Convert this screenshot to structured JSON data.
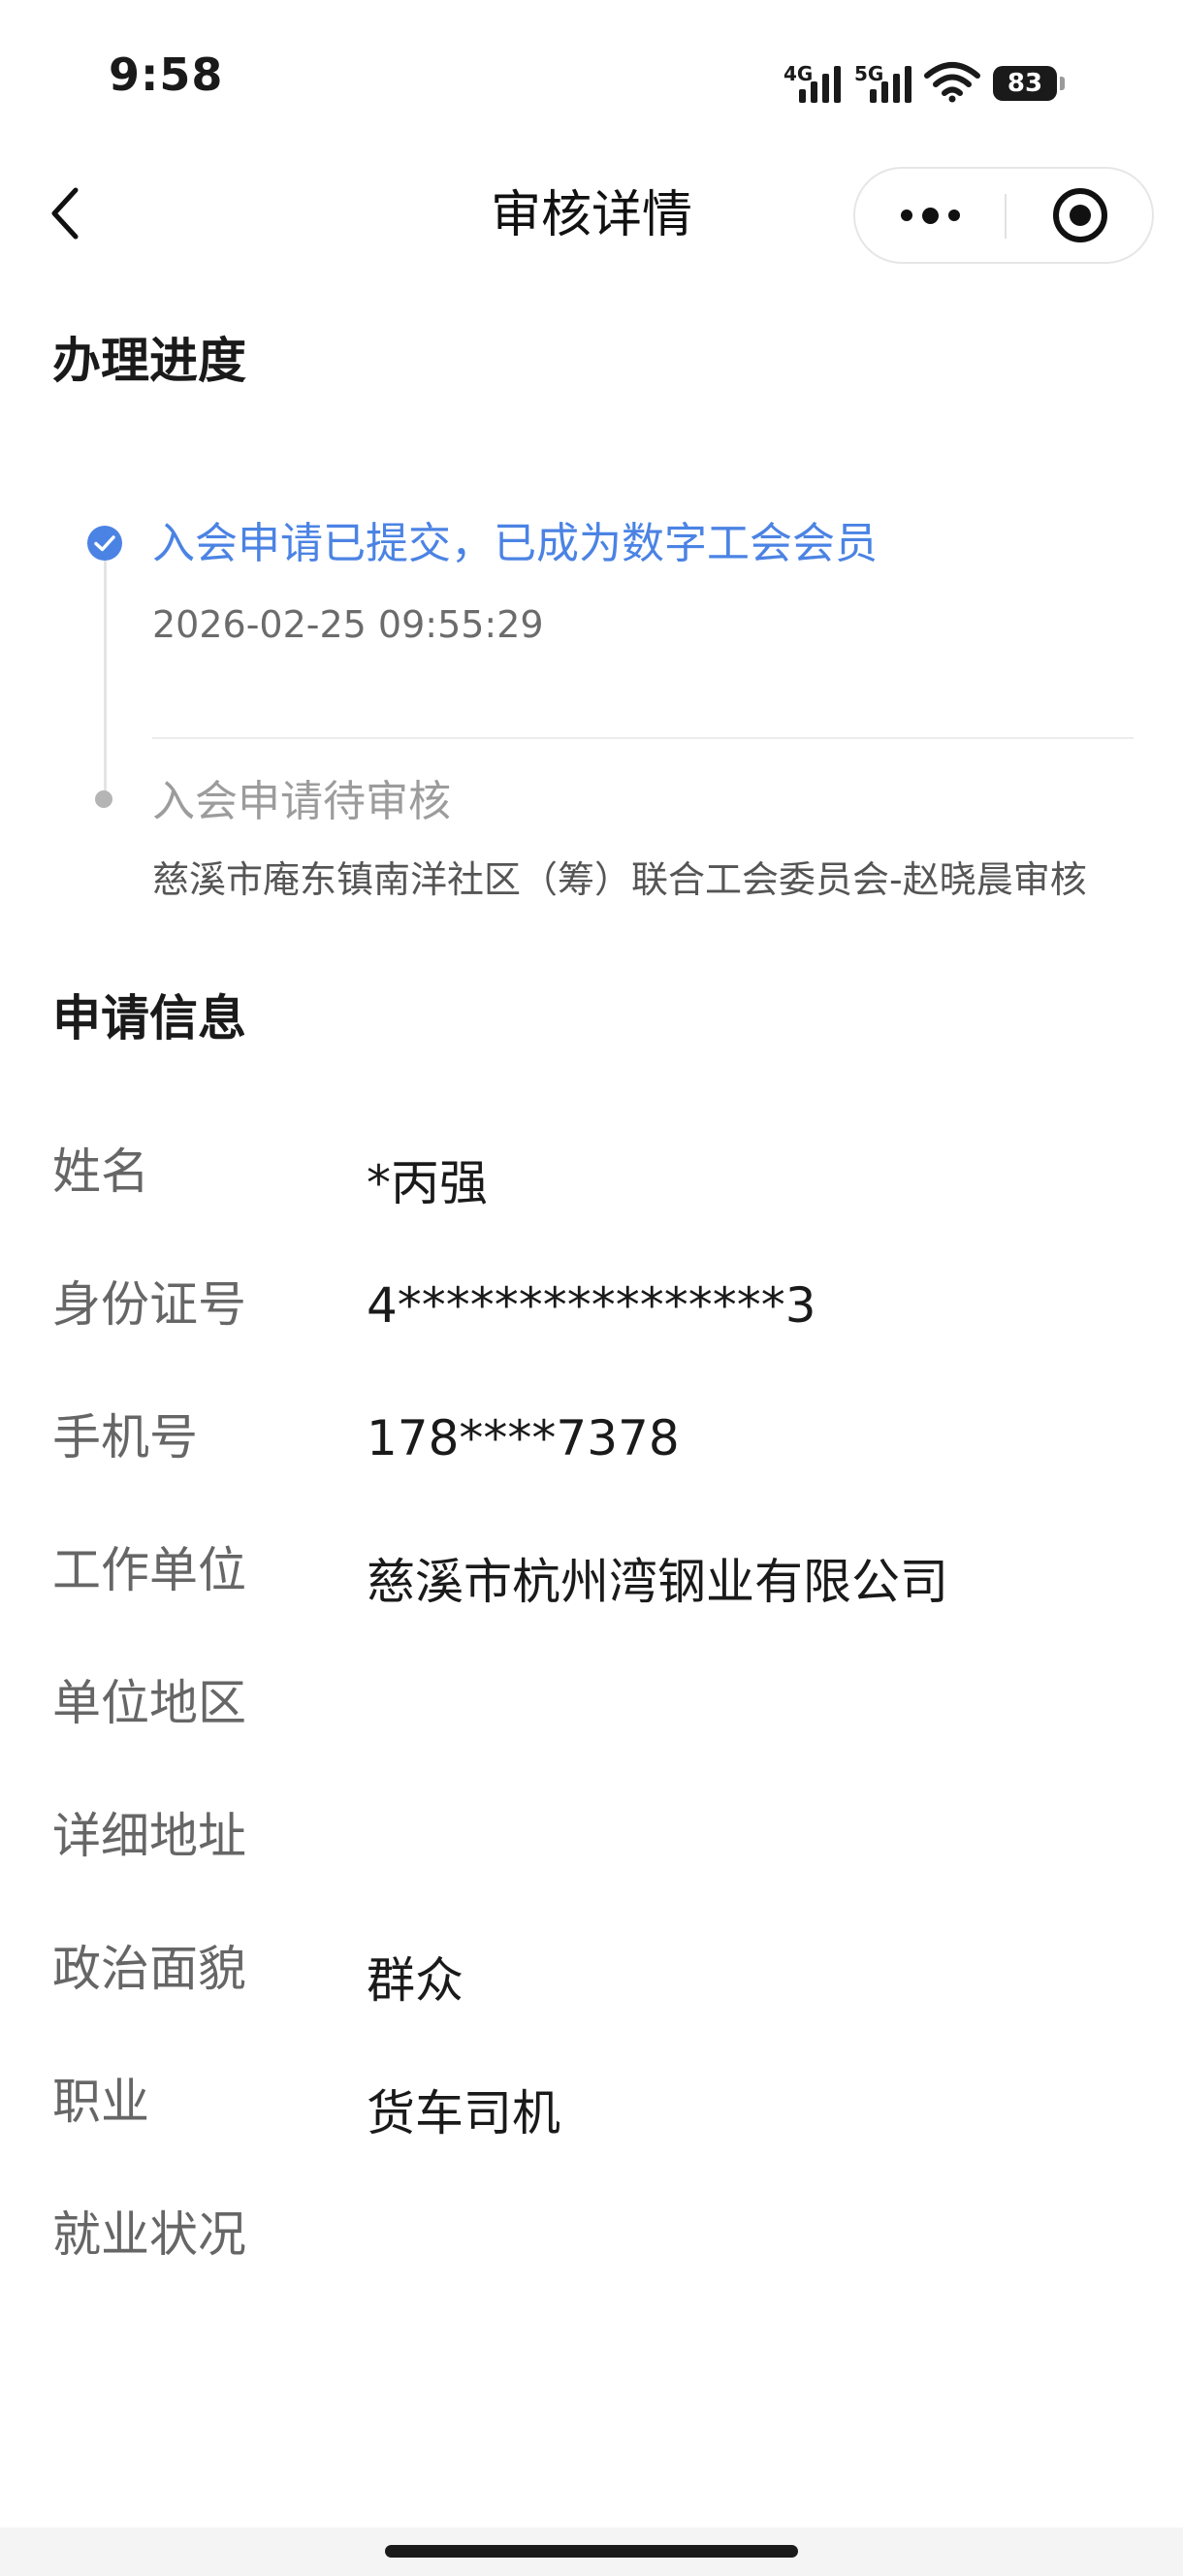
{
  "status_bar": {
    "time": "9:58",
    "network1": "4G",
    "network2": "5G",
    "battery": "83",
    "icons": [
      "signal-icon",
      "wifi-icon",
      "battery-icon"
    ]
  },
  "nav": {
    "title": "审核详情",
    "icons": [
      "back-chevron-icon",
      "more-dots-icon",
      "close-target-icon"
    ]
  },
  "progress": {
    "title": "办理进度",
    "steps": [
      {
        "label": "入会申请已提交，已成为数字工会会员",
        "time": "2026-02-25 09:55:29",
        "status": "done",
        "color": "#4b83e4"
      },
      {
        "label": "入会申请待审核",
        "desc": "慈溪市庵东镇南洋社区（筹）联合工会委员会-赵晓晨审核",
        "status": "pending",
        "color": "#9c9c9c"
      }
    ]
  },
  "info": {
    "title": "申请信息",
    "rows": [
      {
        "label": "姓名",
        "value": "*丙强"
      },
      {
        "label": "身份证号",
        "value": "4****************3"
      },
      {
        "label": "手机号",
        "value": "178****7378"
      },
      {
        "label": "工作单位",
        "value": "慈溪市杭州湾钢业有限公司"
      },
      {
        "label": "单位地区",
        "value": ""
      },
      {
        "label": "详细地址",
        "value": ""
      },
      {
        "label": "政治面貌",
        "value": "群众"
      },
      {
        "label": "职业",
        "value": "货车司机"
      },
      {
        "label": "就业状况",
        "value": ""
      }
    ]
  }
}
